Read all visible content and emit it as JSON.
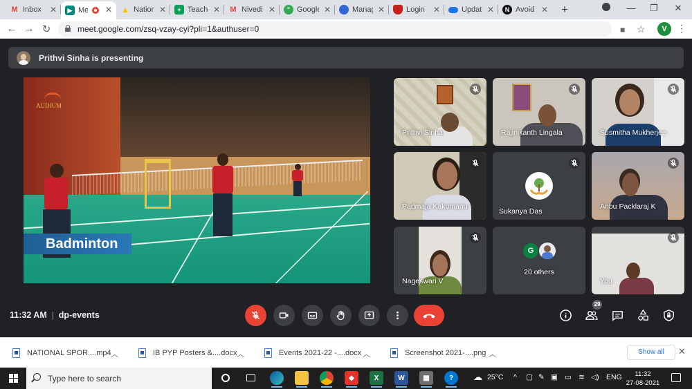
{
  "browser": {
    "tabs": [
      {
        "title": "Inbox (",
        "favicon": "gmail-icon",
        "color": "#ea4335"
      },
      {
        "title": "Me",
        "favicon": "meet-icon",
        "color": "#00897b",
        "active": true
      },
      {
        "title": "Nation",
        "favicon": "drive-icon",
        "color": "#fbbc04"
      },
      {
        "title": "Teache",
        "favicon": "sheets-icon",
        "color": "#0f9d58"
      },
      {
        "title": "Nivedi",
        "favicon": "gmail-icon",
        "color": "#ea4335"
      },
      {
        "title": "Google",
        "favicon": "hangouts-icon",
        "color": "#34a853"
      },
      {
        "title": "Manag",
        "favicon": "globe-icon",
        "color": "#3367d6"
      },
      {
        "title": "Login",
        "favicon": "shield-icon",
        "color": "#c5221f"
      },
      {
        "title": "Update",
        "favicon": "cloud-icon",
        "color": "#1a73e8"
      },
      {
        "title": "Avoid",
        "favicon": "notion-icon",
        "color": "#111111"
      }
    ],
    "url": "meet.google.com/zsq-vzay-cyi?pli=1&authuser=0",
    "profile_initial": "V"
  },
  "meet": {
    "presenting_text": "Prithvi Sinha is presenting",
    "video_caption": "Badminton",
    "video_logo_text": "AUDIUM",
    "participants": [
      {
        "name": "Prithvi Sinha"
      },
      {
        "name": "Rajinikanth Lingala"
      },
      {
        "name": "Susmitha Mukherjee"
      },
      {
        "name": "Padmaja Kakumanu"
      },
      {
        "name": "Sukanya Das"
      },
      {
        "name": "Anbu Packlaraj K"
      },
      {
        "name": "Nageswari V"
      },
      {
        "name": "20 others",
        "avatar_initial": "G"
      },
      {
        "name": "You"
      }
    ],
    "time": "11:32 AM",
    "meeting_code": "dp-events",
    "people_count": "29"
  },
  "downloads": {
    "items": [
      {
        "name": "NATIONAL SPOR....mp4"
      },
      {
        "name": "IB PYP Posters &....docx"
      },
      {
        "name": "Events 2021-22 -....docx"
      },
      {
        "name": "Screenshot 2021-....png"
      }
    ],
    "show_all": "Show all"
  },
  "taskbar": {
    "search_placeholder": "Type here to search",
    "weather": "25°C",
    "language": "ENG",
    "time": "11:32",
    "date": "27-08-2021"
  },
  "colors": {
    "meet_bg": "#202124",
    "tile_bg": "#3c4043",
    "danger": "#ea4335"
  }
}
